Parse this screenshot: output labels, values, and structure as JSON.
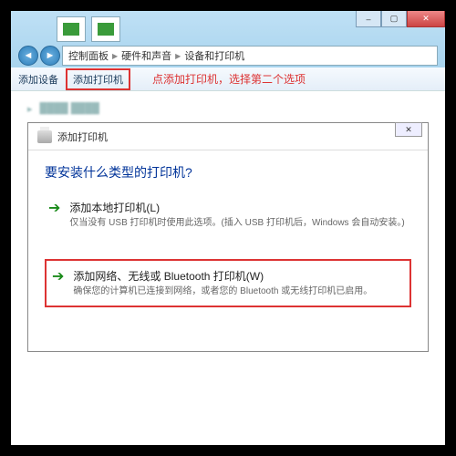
{
  "breadcrumb": {
    "a": "控制面板",
    "b": "硬件和声音",
    "c": "设备和打印机"
  },
  "toolbar": {
    "add_device": "添加设备",
    "add_printer": "添加打印机"
  },
  "annotation": "点添加打印机，选择第二个选项",
  "wizard": {
    "title_bar": "添加打印机",
    "heading": "要安装什么类型的打印机?",
    "option1": {
      "title": "添加本地打印机(L)",
      "desc": "仅当没有 USB 打印机时使用此选项。(插入 USB 打印机后，Windows 会自动安装。)"
    },
    "option2": {
      "title": "添加网络、无线或 Bluetooth 打印机(W)",
      "desc": "确保您的计算机已连接到网络，或者您的 Bluetooth 或无线打印机已启用。"
    }
  }
}
